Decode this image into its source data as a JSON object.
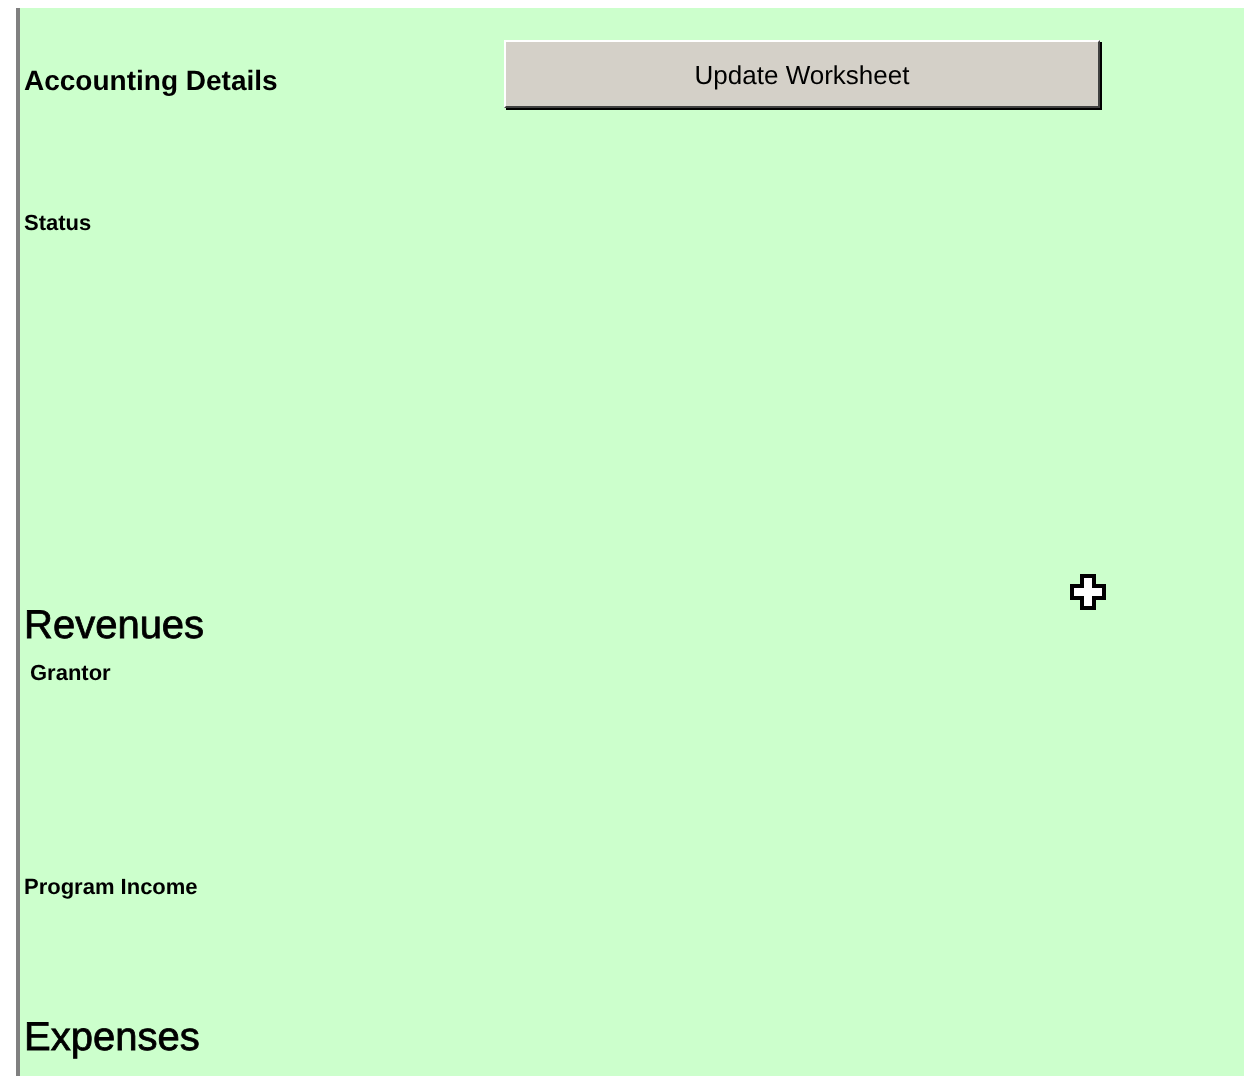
{
  "header": {
    "title": "Accounting Details",
    "button": "Update Worksheet"
  },
  "sections": [
    {
      "kind": "label",
      "text": "Status"
    },
    {
      "kind": "heading",
      "text": "Revenues"
    },
    {
      "kind": "sublabel",
      "text": "Grantor"
    },
    {
      "kind": "label",
      "text": "Program Income"
    },
    {
      "kind": "heading",
      "text": "Expenses"
    }
  ]
}
